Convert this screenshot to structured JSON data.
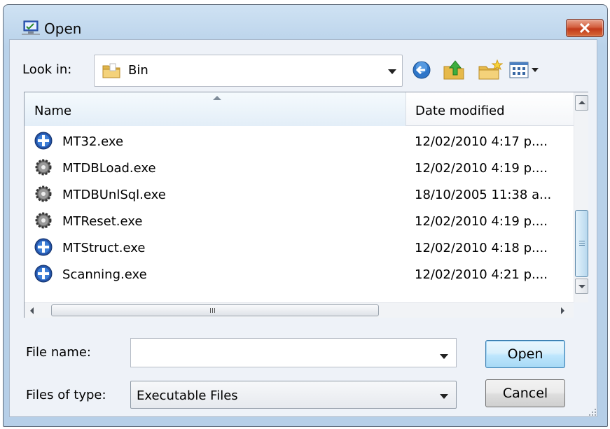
{
  "window": {
    "title": "Open"
  },
  "look_in": {
    "label": "Look in:",
    "value": "Bin"
  },
  "toolbar": {
    "back": "back-icon",
    "up": "up-one-level-icon",
    "new_folder": "new-folder-icon",
    "views": "views-menu-icon"
  },
  "file_list": {
    "columns": [
      "Name",
      "Date modified"
    ],
    "files": [
      {
        "name": "MT32.exe",
        "date": "12/02/2010 4:17 p....",
        "icon": "blue-app-icon"
      },
      {
        "name": "MTDBLoad.exe",
        "date": "12/02/2010 4:19 p....",
        "icon": "gear-app-icon"
      },
      {
        "name": "MTDBUnlSql.exe",
        "date": "18/10/2005 11:38 a...",
        "icon": "gear-app-icon"
      },
      {
        "name": "MTReset.exe",
        "date": "12/02/2010 4:19 p....",
        "icon": "gear-app-icon"
      },
      {
        "name": "MTStruct.exe",
        "date": "12/02/2010 4:18 p....",
        "icon": "blue-app-icon"
      },
      {
        "name": "Scanning.exe",
        "date": "12/02/2010 4:21 p....",
        "icon": "blue-app-icon"
      }
    ]
  },
  "file_name": {
    "label": "File name:",
    "value": ""
  },
  "file_type": {
    "label": "Files of type:",
    "value": "Executable Files"
  },
  "buttons": {
    "open": "Open",
    "cancel": "Cancel"
  },
  "colors": {
    "close_button": "#c23a1a",
    "frame": "#b9d2ea",
    "open_button_border": "#3c7fb1"
  }
}
